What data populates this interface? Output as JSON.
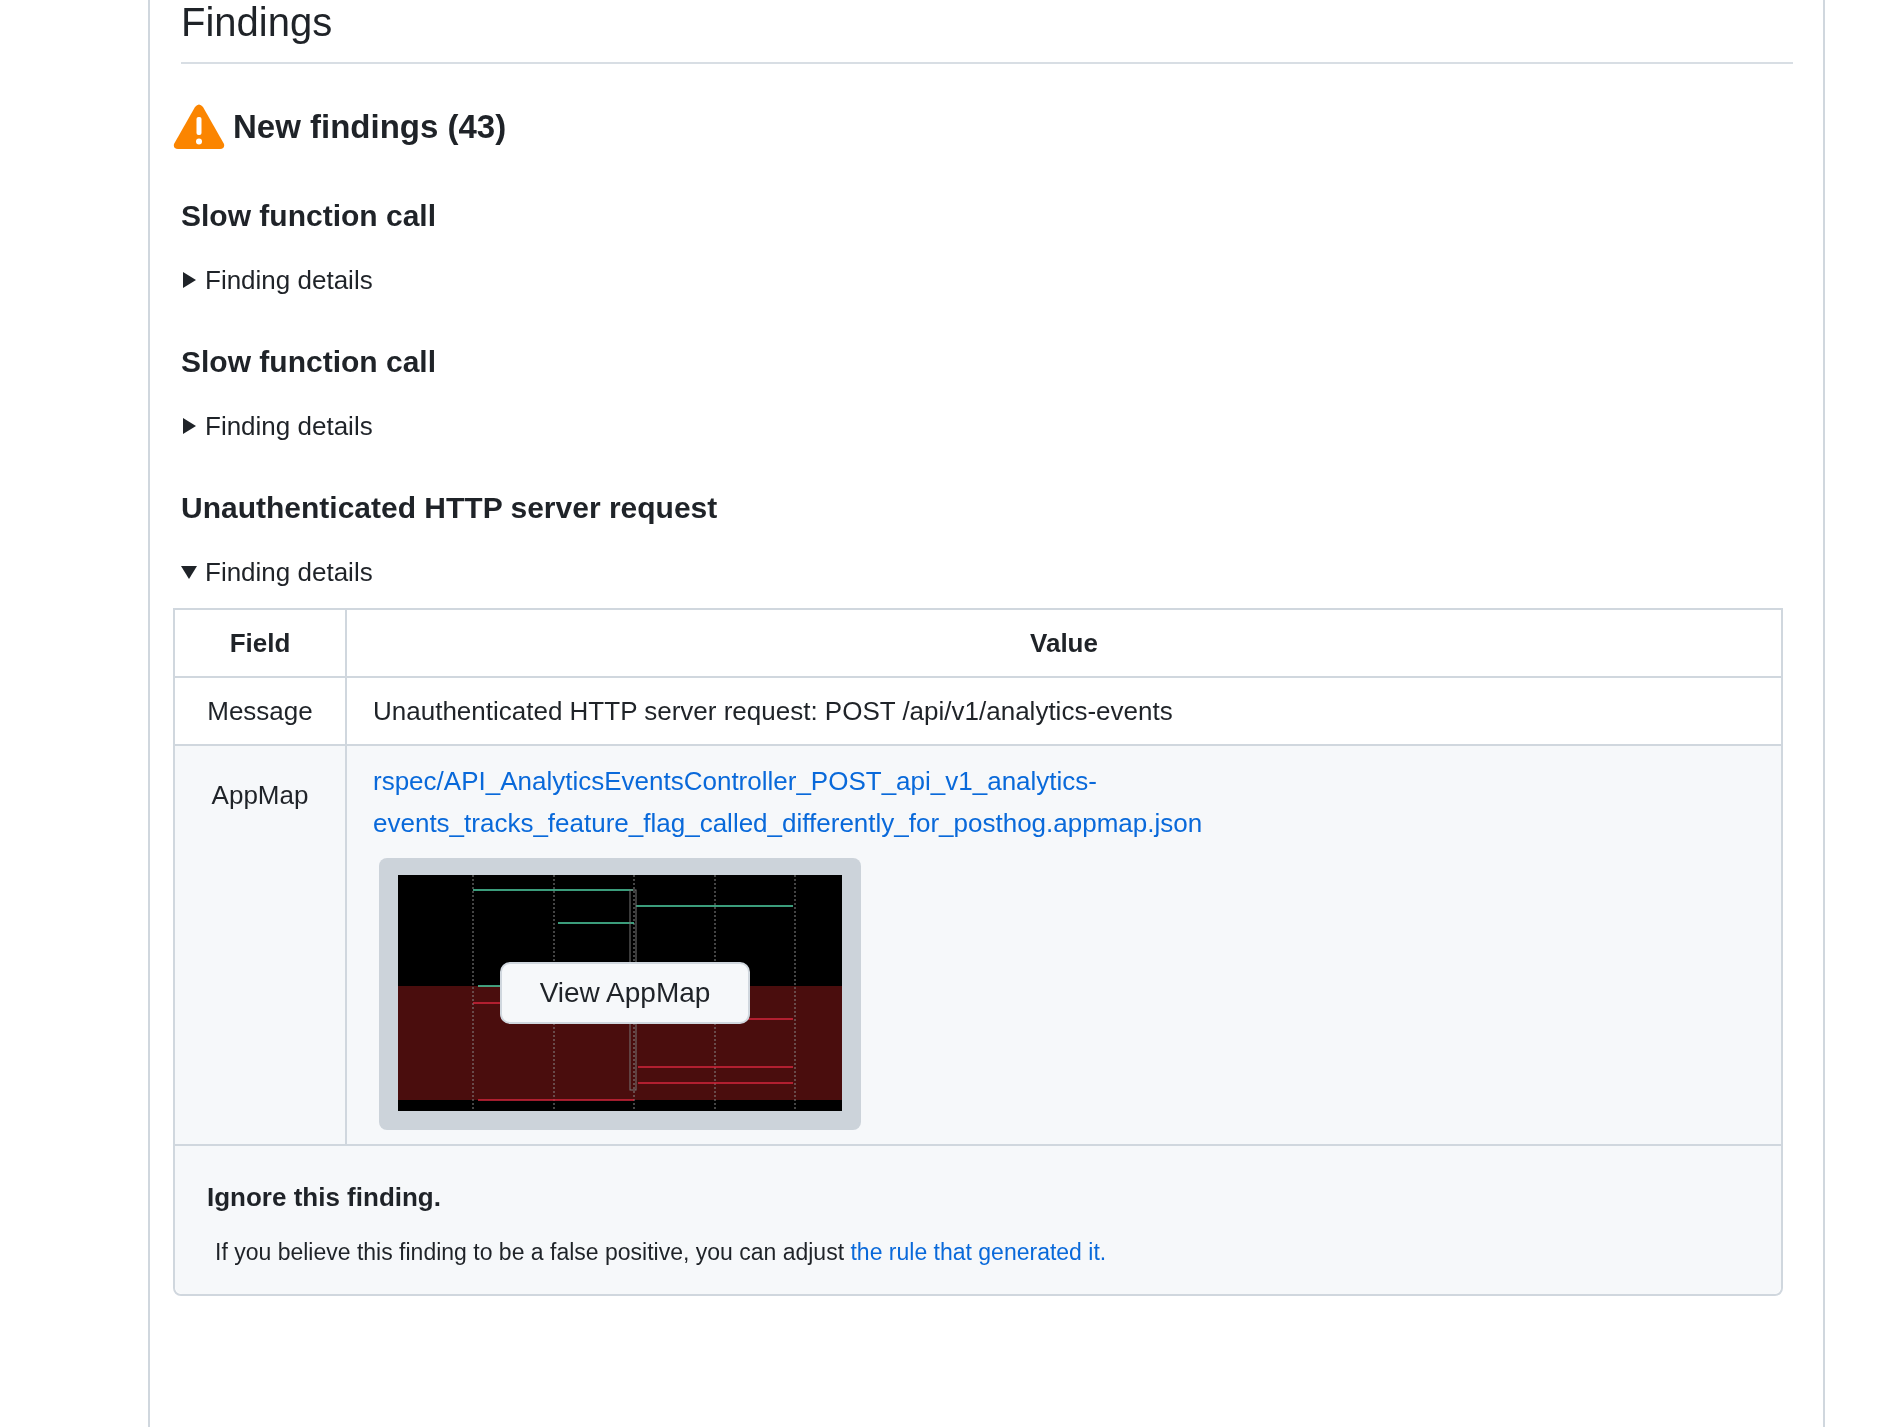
{
  "page_title": "Findings",
  "section": {
    "title": "New findings (43)",
    "findings": [
      {
        "title": "Slow function call",
        "details": {
          "label": "Finding details",
          "expanded": false
        }
      },
      {
        "title": "Slow function call",
        "details": {
          "label": "Finding details",
          "expanded": false
        }
      },
      {
        "title": "Unauthenticated HTTP server request",
        "details": {
          "label": "Finding details",
          "expanded": true,
          "table": {
            "columns": [
              "Field",
              "Value"
            ],
            "rows": [
              {
                "field": "Message",
                "kind": "text",
                "value": "Unauthenticated HTTP server request: POST /api/v1/analytics-events"
              },
              {
                "field": "AppMap",
                "kind": "link",
                "value": "rspec/API_AnalyticsEventsController_POST_api_v1_analytics-events_tracks_feature_flag_called_differently_for_posthog.appmap.json",
                "preview_button": "View AppMap"
              }
            ]
          },
          "ignore": {
            "title": "Ignore this finding.",
            "text": "If you believe this finding to be a false positive, you can adjust ",
            "link": "the rule that generated it."
          }
        }
      }
    ]
  }
}
